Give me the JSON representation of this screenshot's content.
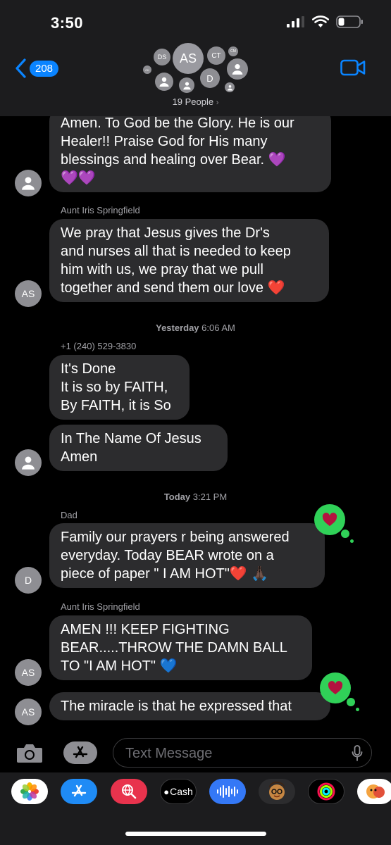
{
  "status": {
    "time": "3:50"
  },
  "header": {
    "back_count": "208",
    "people_label": "19 People",
    "avatars": {
      "ds": "DS",
      "as": "AS",
      "ct": "CT",
      "cm": "CM",
      "ck": "CK",
      "d": "D"
    }
  },
  "messages": [
    {
      "text_lines": [
        "Amen.  To God be the Glory. He is our",
        "Healer!! Praise God for His many",
        "blessings and healing over Bear. 💜",
        "💜💜"
      ]
    },
    {
      "sender": "Aunt Iris Springfield",
      "avatar": "AS",
      "text_lines": [
        "We pray that Jesus gives the Dr's",
        "and nurses all that is needed to keep",
        "him with us, we pray that we pull",
        "together and send them our love ❤️"
      ]
    },
    {
      "stamp_day": "Yesterday",
      "stamp_time": "6:06 AM"
    },
    {
      "sender": "+1 (240) 529-3830",
      "text_lines": [
        "It's Done",
        "It is so by FAITH,",
        "By FAITH, it is So"
      ]
    },
    {
      "text_lines": [
        "In The Name Of Jesus",
        "Amen"
      ]
    },
    {
      "stamp_day": "Today",
      "stamp_time": "3:21 PM"
    },
    {
      "sender": "Dad",
      "avatar": "D",
      "text_lines": [
        "Family our prayers r being answered",
        "everyday. Today BEAR wrote on a",
        "piece of paper \" I AM HOT\"❤️ 🙏🏿"
      ]
    },
    {
      "sender": "Aunt Iris Springfield",
      "avatar": "AS",
      "text_lines": [
        "AMEN !!! KEEP FIGHTING",
        "BEAR.....THROW THE DAMN BALL",
        "TO \"I AM HOT\" 💙"
      ]
    },
    {
      "avatar": "AS",
      "text_lines": [
        "The miracle is that he expressed that"
      ]
    }
  ],
  "input": {
    "placeholder": "Text Message"
  },
  "app_drawer": {
    "cash_label": "Cash"
  },
  "colors": {
    "accent": "#0a84ff",
    "bubble": "#2c2c2e",
    "tapback": "#30d158",
    "heart": "#e0245e"
  }
}
